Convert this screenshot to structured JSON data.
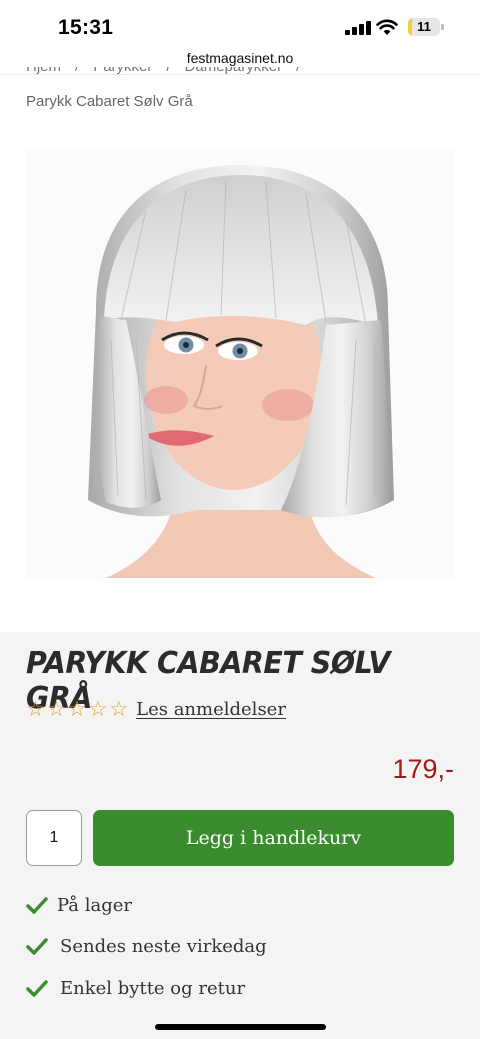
{
  "status_bar": {
    "time": "15:31",
    "battery_level": "11",
    "battery_fraction": 0.11,
    "signal_icon": "cellular-signal-icon",
    "wifi_icon": "wifi-icon"
  },
  "browser": {
    "url": "festmagasinet.no"
  },
  "breadcrumb": {
    "items": [
      "Hjem",
      "Parykker",
      "Dameparykker"
    ],
    "separator": "/",
    "current": "Parykk Cabaret Sølv Grå"
  },
  "product": {
    "image_icon": "product-photo-silver-bob-wig",
    "title": "PARYKK CABARET SØLV GRÅ",
    "rating_stars": 5,
    "rating_value": 0,
    "reviews_link": "Les anmeldelser",
    "price": "179,-",
    "quantity": "1",
    "add_to_cart": "Legg i handlekurv"
  },
  "usps": [
    {
      "label": "På lager",
      "icon": "check-icon"
    },
    {
      "label": "Sendes neste virkedag",
      "icon": "check-icon"
    },
    {
      "label": "Enkel bytte og retur",
      "icon": "check-icon"
    }
  ],
  "colors": {
    "accent_green": "#3a8c2f",
    "price_red": "#a01c1c",
    "star_orange": "#e0a030",
    "panel_bg": "#f4f4f4"
  }
}
